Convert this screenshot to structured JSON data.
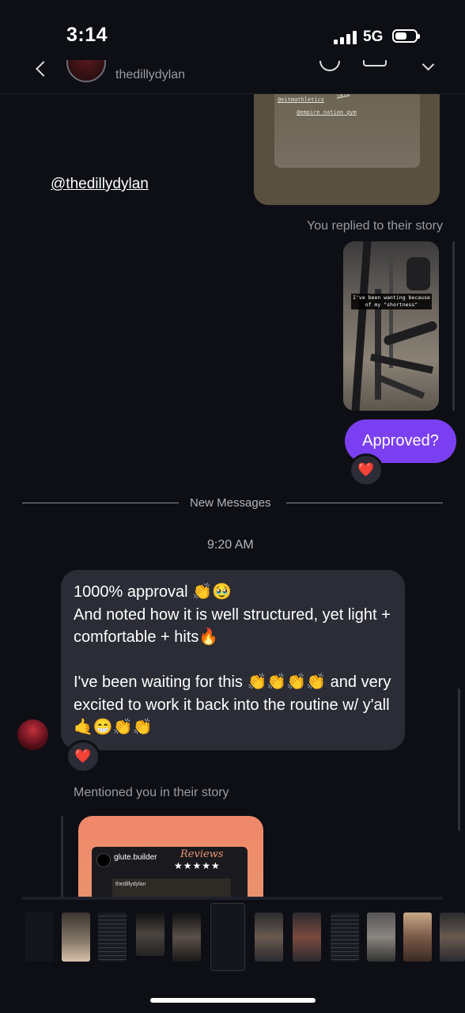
{
  "status_bar": {
    "time": "3:14",
    "network": "5G"
  },
  "header": {
    "username": "thedillydylan"
  },
  "story_reply": {
    "story_tags": [
      "@eitmathletics",
      "lala",
      "@empire_nation_gym"
    ],
    "mention_handle": "@thedillydylan",
    "replied_label": "You replied to their story",
    "thumb_caption": "I've been wanting because of my \"shortness\"",
    "reply_text": "Approved?",
    "reaction": "❤️"
  },
  "divider": {
    "label": "New Messages"
  },
  "timestamp": "9:20 AM",
  "incoming_message": {
    "text": "1000% approval 👏🥹\nAnd noted how it is well structured, yet light + comfortable + hits🔥\n\n I've been waiting for this 👏👏👏👏 and very excited to work it back into the routine w/ y'all 🤙😁👏👏",
    "reaction": "❤️"
  },
  "mention_story": {
    "label": "Mentioned you in their story",
    "handle": "glute.builder",
    "reviews_title": "Reviews",
    "stars": "★★★★★",
    "sub_handle": "thedillydylan"
  },
  "thumbnail_strip": {
    "count": 13
  },
  "colors": {
    "background": "#0e0f15",
    "outgoing_bubble": "#7b3ff2",
    "incoming_bubble": "#2b2c35",
    "heart": "#e2192c"
  }
}
